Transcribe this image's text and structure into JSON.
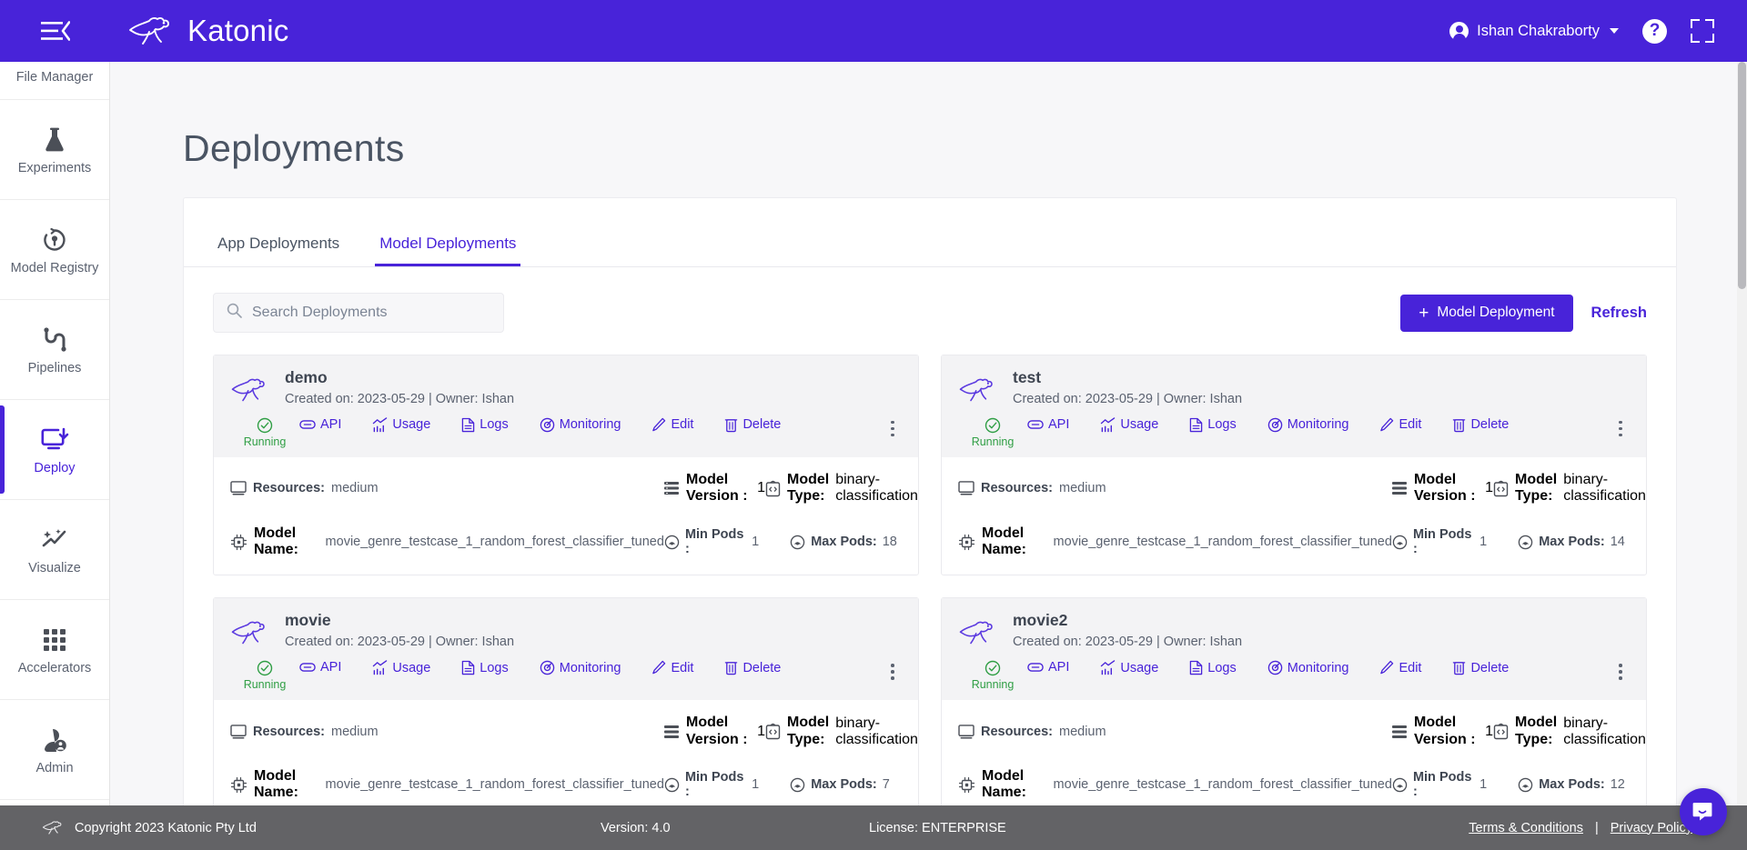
{
  "topbar": {
    "menu_icon": "hamburger-collapse-icon",
    "brand": "Katonic",
    "user_name": "Ishan Chakraborty",
    "help_label": "?",
    "fullscreen_icon": "fullscreen-icon"
  },
  "sidebar": {
    "items": [
      {
        "label": "File Manager",
        "icon": "folder-icon",
        "active": false
      },
      {
        "label": "Experiments",
        "icon": "flask-icon",
        "active": false
      },
      {
        "label": "Model Registry",
        "icon": "model-registry-icon",
        "active": false
      },
      {
        "label": "Pipelines",
        "icon": "pipelines-icon",
        "active": false
      },
      {
        "label": "Deploy",
        "icon": "deploy-icon",
        "active": true
      },
      {
        "label": "Visualize",
        "icon": "sparkle-chart-icon",
        "active": false
      },
      {
        "label": "Accelerators",
        "icon": "grid-icon",
        "active": false
      },
      {
        "label": "Admin",
        "icon": "admin-user-icon",
        "active": false
      }
    ]
  },
  "page": {
    "title": "Deployments"
  },
  "tabs": [
    {
      "label": "App Deployments",
      "active": false
    },
    {
      "label": "Model Deployments",
      "active": true
    }
  ],
  "toolbar": {
    "search_placeholder": "Search Deployments",
    "search_value": "",
    "search_icon": "search-icon",
    "new_button_label": "Model Deployment",
    "new_button_plus": "+",
    "refresh_label": "Refresh",
    "accent_color": "#4823d9"
  },
  "labels": {
    "status_running": "Running",
    "api": "API",
    "usage": "Usage",
    "logs": "Logs",
    "monitoring": "Monitoring",
    "edit": "Edit",
    "delete": "Delete",
    "resources": "Resources:",
    "model_version": "Model Version :",
    "model_type": "Model Type:",
    "model_name": "Model Name:",
    "min_pods": "Min Pods :",
    "max_pods": "Max Pods:"
  },
  "cards": [
    {
      "name": "demo",
      "subtitle": "Created on: 2023-05-29 | Owner: Ishan",
      "status": "Running",
      "resources": "medium",
      "model_version": "1",
      "model_type": "binary-classification",
      "model_name": "movie_genre_testcase_1_random_forest_classifier_tuned",
      "min_pods": "1",
      "max_pods": "18"
    },
    {
      "name": "test",
      "subtitle": "Created on: 2023-05-29 | Owner: Ishan",
      "status": "Running",
      "resources": "medium",
      "model_version": "1",
      "model_type": "binary-classification",
      "model_name": "movie_genre_testcase_1_random_forest_classifier_tuned",
      "min_pods": "1",
      "max_pods": "14"
    },
    {
      "name": "movie",
      "subtitle": "Created on: 2023-05-29 | Owner: Ishan",
      "status": "Running",
      "resources": "medium",
      "model_version": "1",
      "model_type": "binary-classification",
      "model_name": "movie_genre_testcase_1_random_forest_classifier_tuned",
      "min_pods": "1",
      "max_pods": "7"
    },
    {
      "name": "movie2",
      "subtitle": "Created on: 2023-05-29 | Owner: Ishan",
      "status": "Running",
      "resources": "medium",
      "model_version": "1",
      "model_type": "binary-classification",
      "model_name": "movie_genre_testcase_1_random_forest_classifier_tuned",
      "min_pods": "1",
      "max_pods": "12"
    }
  ],
  "footer": {
    "copyright": "Copyright 2023 Katonic Pty Ltd",
    "version": "Version: 4.0",
    "license": "License: ENTERPRISE",
    "terms": "Terms & Conditions",
    "separator": "|",
    "privacy": "Privacy Policy"
  },
  "chat": {
    "icon": "chat-bubble-icon"
  }
}
